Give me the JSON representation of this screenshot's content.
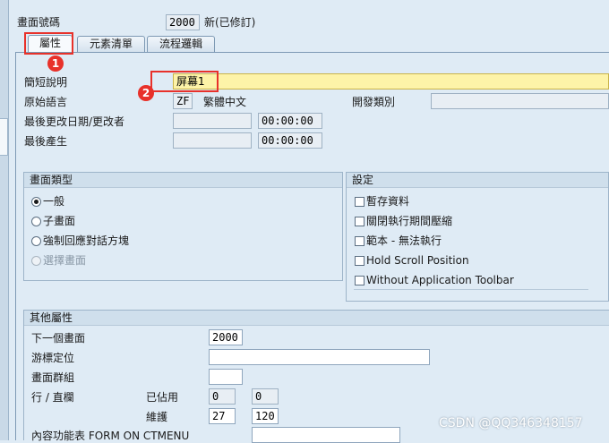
{
  "header": {
    "screen_number_label": "畫面號碼",
    "screen_number": "2000",
    "status": "新(已修訂)"
  },
  "tabs": [
    {
      "label": "屬性"
    },
    {
      "label": "元素清單"
    },
    {
      "label": "流程邏輯"
    }
  ],
  "attributes": {
    "short_desc_label": "簡短說明",
    "short_desc_value": "屏幕1",
    "orig_lang_label": "原始語言",
    "orig_lang_code": "ZF",
    "orig_lang_name": "繁體中文",
    "dev_class_label": "開發類別",
    "dev_class_value": "",
    "last_changed_label": "最後更改日期/更改者",
    "last_changed_date": "",
    "last_changed_time": "00:00:00",
    "last_gen_label": "最後產生",
    "last_gen_date": "",
    "last_gen_time": "00:00:00"
  },
  "screen_type": {
    "title": "畫面類型",
    "options": [
      "一般",
      "子畫面",
      "強制回應對話方塊",
      "選擇畫面"
    ]
  },
  "settings": {
    "title": "設定",
    "options": [
      "暫存資料",
      "關閉執行期間壓縮",
      "範本 - 無法執行",
      "Hold Scroll Position",
      "Without Application Toolbar"
    ]
  },
  "other": {
    "title": "其他屬性",
    "next_screen_label": "下一個畫面",
    "next_screen_value": "2000",
    "cursor_label": "游標定位",
    "cursor_value": "",
    "screen_group_label": "畫面群組",
    "screen_group_value": "",
    "row_col_label": "行 / 直欄",
    "occupied_label": "已佔用",
    "occupied_row": "0",
    "occupied_col": "0",
    "maintain_label": "維護",
    "maintain_row": "27",
    "maintain_col": "120",
    "context_menu_label": "內容功能表 FORM ON CTMENU",
    "context_menu_value": ""
  },
  "annotations": {
    "badge1": "1",
    "badge2": "2",
    "color": "#e8312a"
  },
  "watermark": "CSDN @QQ346348157"
}
